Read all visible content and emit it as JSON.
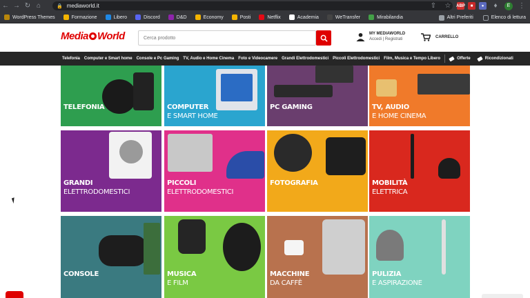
{
  "browser": {
    "url": "mediaworld.it",
    "nav_icons": [
      "back-icon",
      "forward-icon",
      "reload-icon",
      "home-icon"
    ],
    "bookmarks": [
      {
        "label": "WordPress Themes",
        "color": "#b8860b"
      },
      {
        "label": "Formazione",
        "color": "#f4b400"
      },
      {
        "label": "Libero",
        "color": "#1e88e5"
      },
      {
        "label": "Discord",
        "color": "#5865f2"
      },
      {
        "label": "D&D",
        "color": "#8e24aa"
      },
      {
        "label": "Economy",
        "color": "#f4b400"
      },
      {
        "label": "Posti",
        "color": "#f4b400"
      },
      {
        "label": "Netflix",
        "color": "#e50914"
      },
      {
        "label": "Academia",
        "color": "#ffffff"
      },
      {
        "label": "WeTransfer",
        "color": "#444444"
      },
      {
        "label": "Mirabilandia",
        "color": "#43a047"
      }
    ],
    "bookmarks_right": [
      "Altri Preferiti",
      "Elenco di lettura"
    ],
    "profile_initial": "E"
  },
  "header": {
    "logo_text_1": "Media",
    "logo_text_2": "World",
    "search_placeholder": "Cerca prodotto",
    "account_title": "MY MEDIAWORLD",
    "account_sub": "Accedi | Registrati",
    "cart_label": "CARRELLO",
    "brand_color": "#df0000"
  },
  "categories": [
    "Telefonia",
    "Computer e Smart home",
    "Console e Pc Gaming",
    "TV, Audio e Home Cinema",
    "Foto e Videocamere",
    "Grandi Elettrodomestici",
    "Piccoli Elettrodomestici",
    "Film, Musica e Tempo Libero"
  ],
  "category_badges": [
    "Offerte",
    "Ricondizionati"
  ],
  "tiles": [
    {
      "line1": "TELEFONIA",
      "line2": "",
      "bg": "#2e9e4f"
    },
    {
      "line1": "COMPUTER",
      "line2": "E SMART HOME",
      "bg": "#2aa5cf"
    },
    {
      "line1": "PC GAMING",
      "line2": "",
      "bg": "#6a3e6e"
    },
    {
      "line1": "TV, AUDIO",
      "line2": "E HOME CINEMA",
      "bg": "#f07a2a"
    },
    {
      "line1": "GRANDI",
      "line2": "ELETTRODOMESTICI",
      "bg": "#7c2a8e"
    },
    {
      "line1": "PICCOLI",
      "line2": "ELETTRODOMESTICI",
      "bg": "#e0308a"
    },
    {
      "line1": "FOTOGRAFIA",
      "line2": "",
      "bg": "#f2a91a"
    },
    {
      "line1": "MOBILITÀ",
      "line2": "ELETTRICA",
      "bg": "#d9281e"
    },
    {
      "line1": "CONSOLE",
      "line2": "",
      "bg": "#3a7a80"
    },
    {
      "line1": "MUSICA",
      "line2": "E FILM",
      "bg": "#7ac943"
    },
    {
      "line1": "MACCHINE",
      "line2": "DA CAFFÈ",
      "bg": "#b8724e"
    },
    {
      "line1": "PULIZIA",
      "line2": "E ASPIRAZIONE",
      "bg": "#7fd3c0"
    }
  ]
}
